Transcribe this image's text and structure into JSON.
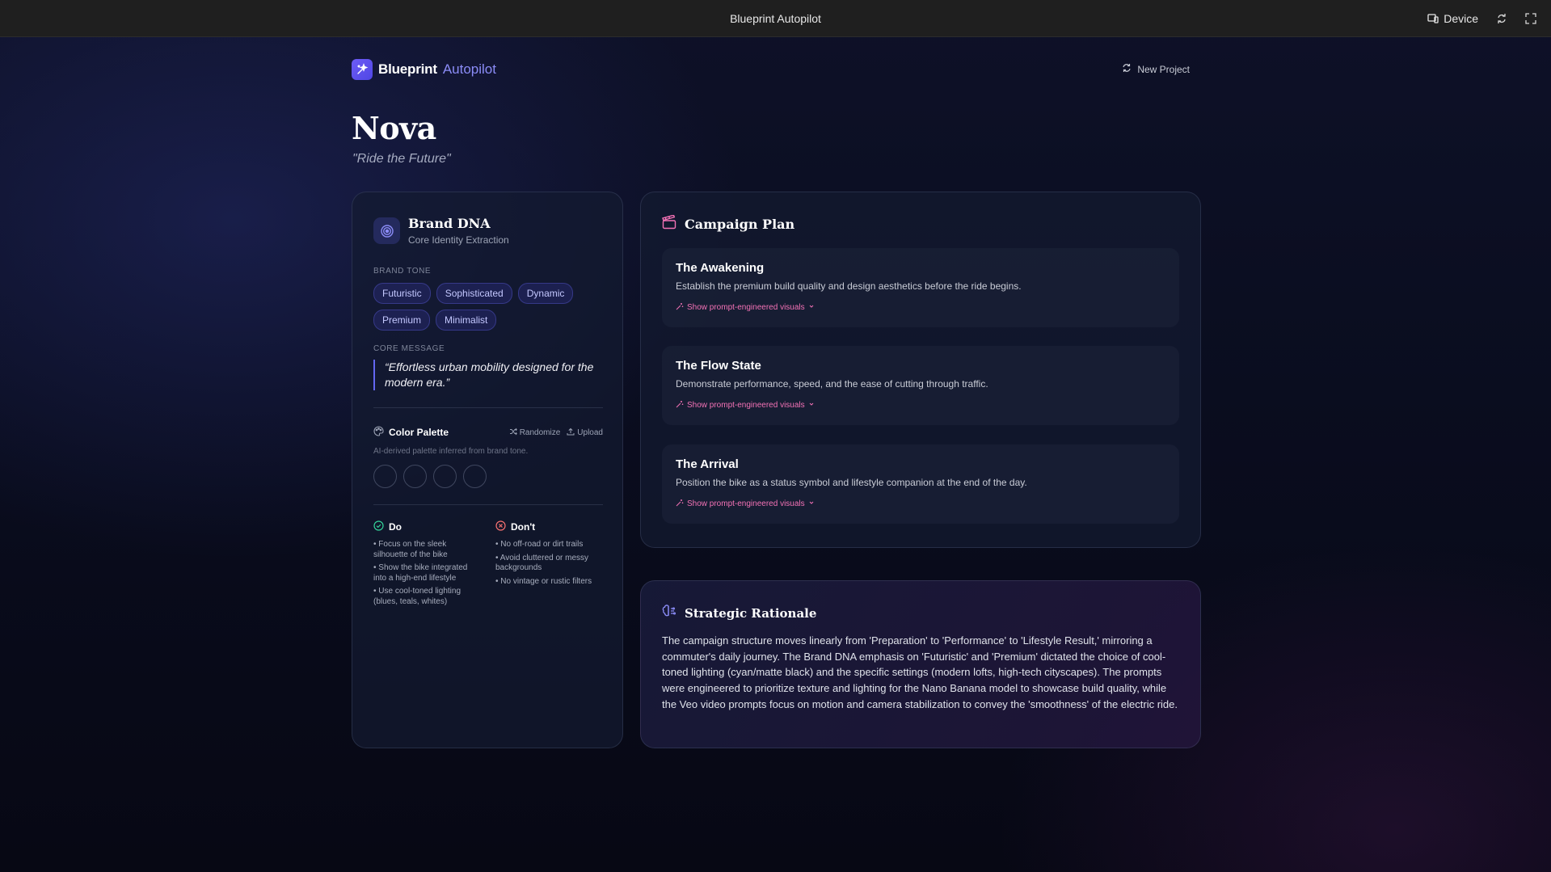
{
  "window": {
    "title": "Blueprint Autopilot",
    "device_label": "Device"
  },
  "header": {
    "logo_main": "Blueprint",
    "logo_accent": "Autopilot",
    "new_project_label": "New Project"
  },
  "brand": {
    "name": "Nova",
    "tagline": "\"Ride the Future\""
  },
  "brand_dna": {
    "title": "Brand DNA",
    "subtitle": "Core Identity Extraction",
    "tone_label": "BRAND TONE",
    "tones": [
      "Futuristic",
      "Sophisticated",
      "Dynamic",
      "Premium",
      "Minimalist"
    ],
    "core_message_label": "CORE MESSAGE",
    "core_message": "“Effortless urban mobility designed for the modern era.”",
    "palette": {
      "title": "Color Palette",
      "randomize_label": "Randomize",
      "upload_label": "Upload",
      "hint": "AI-derived palette inferred from brand tone."
    },
    "do": {
      "title": "Do",
      "items": [
        "• Focus on the sleek silhouette of the bike",
        "• Show the bike integrated into a high-end lifestyle",
        "• Use cool-toned lighting (blues, teals, whites)"
      ]
    },
    "dont": {
      "title": "Don't",
      "items": [
        "• No off-road or dirt trails",
        "• Avoid cluttered or messy backgrounds",
        "• No vintage or rustic filters"
      ]
    }
  },
  "campaign_plan": {
    "title": "Campaign Plan",
    "phases": [
      {
        "title": "The Awakening",
        "description": "Establish the premium build quality and design aesthetics before the ride begins.",
        "link_label": "Show prompt-engineered visuals"
      },
      {
        "title": "The Flow State",
        "description": "Demonstrate performance, speed, and the ease of cutting through traffic.",
        "link_label": "Show prompt-engineered visuals"
      },
      {
        "title": "The Arrival",
        "description": "Position the bike as a status symbol and lifestyle companion at the end of the day.",
        "link_label": "Show prompt-engineered visuals"
      }
    ]
  },
  "rationale": {
    "title": "Strategic Rationale",
    "body": "The campaign structure moves linearly from 'Preparation' to 'Performance' to 'Lifestyle Result,' mirroring a commuter's daily journey. The Brand DNA emphasis on 'Futuristic' and 'Premium' dictated the choice of cool-toned lighting (cyan/matte black) and the specific settings (modern lofts, high-tech cityscapes). The prompts were engineered to prioritize texture and lighting for the Nano Banana model to showcase build quality, while the Veo video prompts focus on motion and camera stabilization to convey the 'smoothness' of the electric ride."
  },
  "colors": {
    "accent": "#6366f1",
    "link_pink": "#f472b6",
    "do_green": "#34d399",
    "dont_red": "#f87171"
  }
}
